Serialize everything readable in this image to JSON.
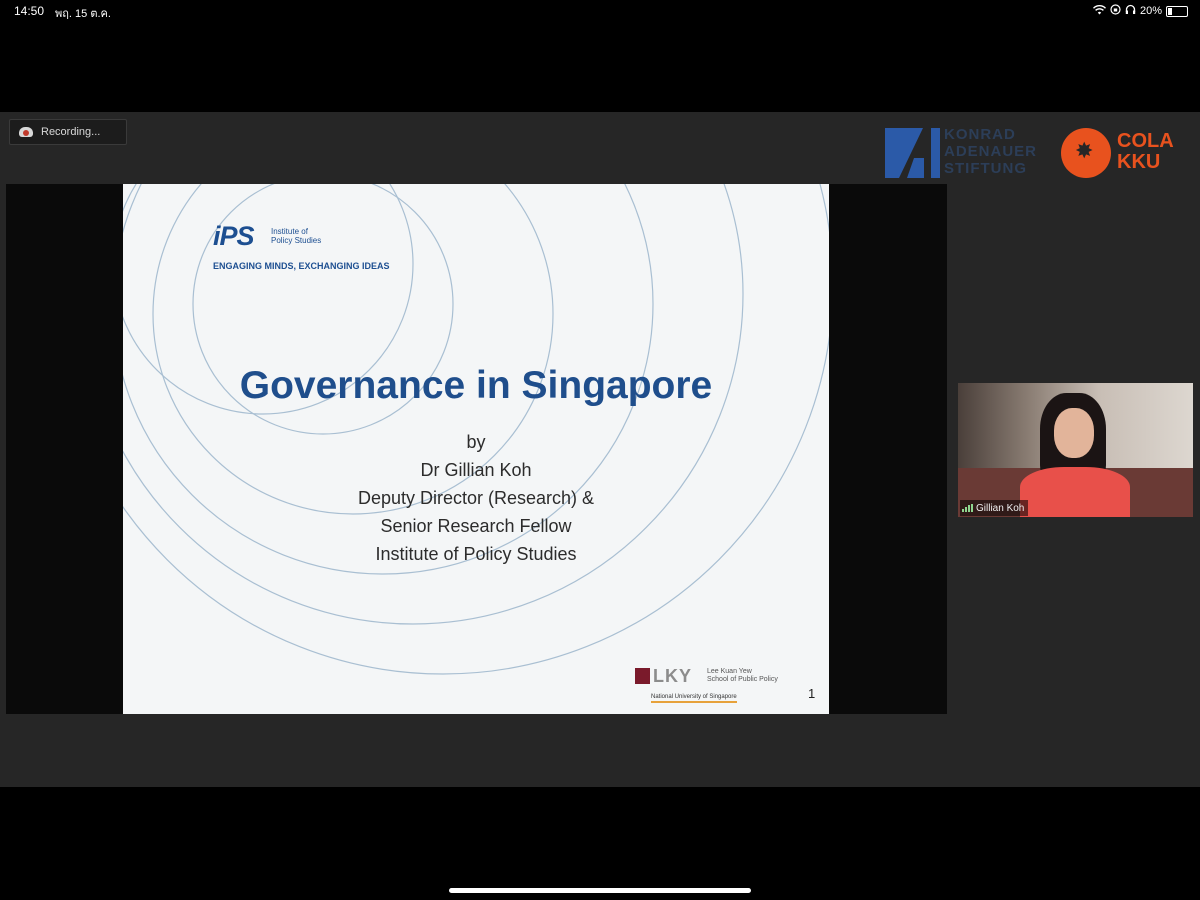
{
  "status_bar": {
    "time": "14:50",
    "date": "พฤ. 15 ต.ค.",
    "battery": "20%",
    "battery_level": 0.2
  },
  "meeting": {
    "recording_label": "Recording..."
  },
  "sponsors": {
    "kas_lines": [
      "KONRAD",
      "ADENAUER",
      "STIFTUNG"
    ],
    "cola_lines": [
      "COLA",
      "KKU"
    ],
    "cola_color": "#e8521e",
    "kas_color": "#2b5aa8"
  },
  "slide": {
    "logo_letters": "iPS",
    "logo_name_lines": [
      "Institute of",
      "Policy Studies"
    ],
    "tagline": "ENGAGING MINDS, EXCHANGING IDEAS",
    "title": "Governance in Singapore",
    "byline": [
      "by",
      "Dr Gillian Koh",
      "Deputy Director (Research) &",
      "Senior Research Fellow",
      "Institute of Policy Studies"
    ],
    "lky_letters": "LKY",
    "lky_school_lines": [
      "Lee Kuan Yew",
      "School of Public Policy"
    ],
    "nus": "National University of Singapore",
    "page_number": "1",
    "title_color": "#1f4e8c"
  },
  "participant": {
    "name": "Gillian Koh"
  }
}
